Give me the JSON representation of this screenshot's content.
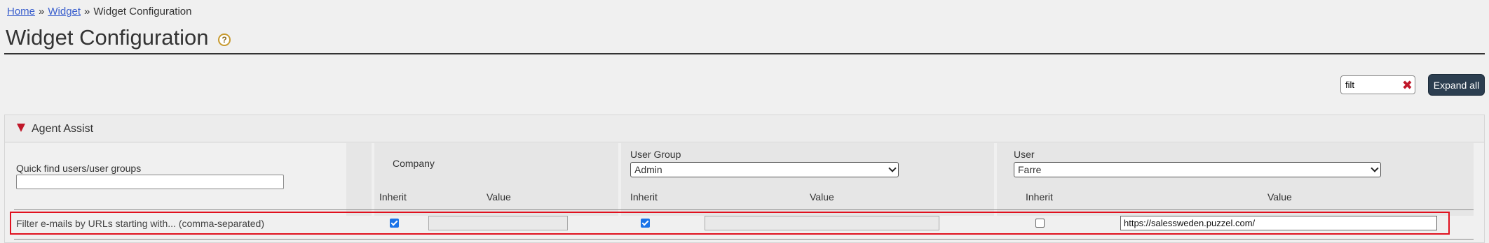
{
  "breadcrumb": {
    "home": "Home",
    "sep1": "»",
    "widget": "Widget",
    "sep2": "»",
    "current": "Widget Configuration"
  },
  "page": {
    "title": "Widget Configuration",
    "help_icon": "?"
  },
  "toolbar": {
    "filter_value": "filt",
    "clear_icon": "✖",
    "expand_all_label": "Expand all"
  },
  "panel": {
    "title": "Agent Assist",
    "quick_find_label": "Quick find users/user groups",
    "company": {
      "label": "Company",
      "inherit_label": "Inherit",
      "value_label": "Value"
    },
    "user_group": {
      "label": "User Group",
      "selected": "Admin",
      "inherit_label": "Inherit",
      "value_label": "Value"
    },
    "user": {
      "label": "User",
      "selected": "Farre",
      "inherit_label": "Inherit",
      "value_label": "Value"
    }
  },
  "rows": [
    {
      "label": "Filter e-mails by URLs starting with... (comma-separated)",
      "company_inherit": true,
      "company_value": "",
      "group_inherit": true,
      "group_value": "",
      "user_inherit": false,
      "user_value": "https://salessweden.puzzel.com/"
    }
  ],
  "colors": {
    "accent": "#2c3e50",
    "highlight": "#e0101e",
    "link": "#3a5fcd",
    "checkbox": "#1a73e8"
  }
}
